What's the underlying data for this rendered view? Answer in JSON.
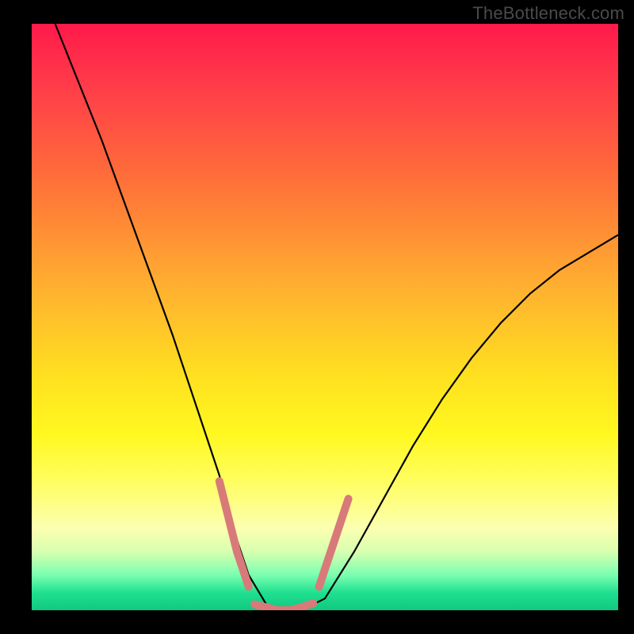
{
  "attribution": "TheBottleneck.com",
  "colors": {
    "frame": "#000000",
    "curve": "#000000",
    "marker": "#d87a7a",
    "gradient_top": "#ff1a4a",
    "gradient_mid": "#ffe020",
    "gradient_bottom": "#10c880"
  },
  "chart_data": {
    "type": "line",
    "title": "",
    "xlabel": "",
    "ylabel": "",
    "xlim": [
      0,
      100
    ],
    "ylim": [
      0,
      100
    ],
    "grid": false,
    "legend": false,
    "annotations": [],
    "series": [
      {
        "name": "bottleneck-curve",
        "x": [
          4,
          8,
          12,
          16,
          20,
          24,
          28,
          32,
          34,
          37,
          40,
          43,
          46,
          50,
          55,
          60,
          65,
          70,
          75,
          80,
          85,
          90,
          95,
          100
        ],
        "y": [
          100,
          90,
          80,
          69,
          58,
          47,
          35,
          23,
          15,
          6,
          1,
          0,
          0,
          2,
          10,
          19,
          28,
          36,
          43,
          49,
          54,
          58,
          61,
          64
        ]
      }
    ],
    "markers": {
      "name": "highlight-segments",
      "color": "#d87a7a",
      "thickness": 10,
      "segments": [
        {
          "x": [
            32,
            33,
            34,
            35,
            36,
            37
          ],
          "y": [
            22,
            18,
            14,
            10,
            7,
            4
          ]
        },
        {
          "x": [
            38,
            40,
            42,
            44,
            46,
            48
          ],
          "y": [
            1,
            0.5,
            0,
            0,
            0.5,
            1.2
          ]
        },
        {
          "x": [
            49,
            50,
            51,
            52,
            53,
            54
          ],
          "y": [
            4,
            7,
            10,
            13,
            16,
            19
          ]
        }
      ]
    }
  }
}
